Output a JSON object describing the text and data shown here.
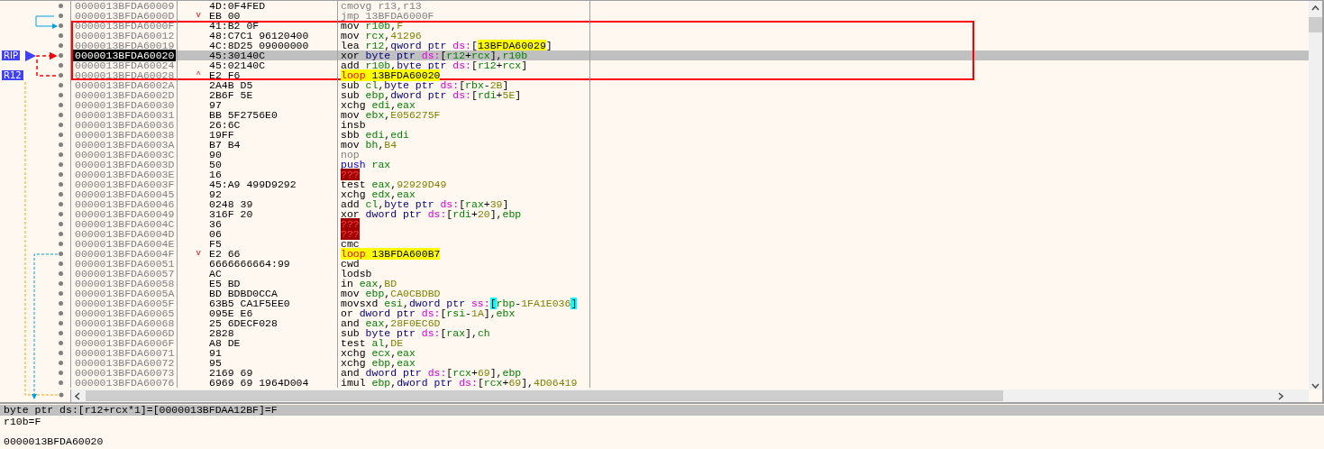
{
  "rows": [
    {
      "address": "0000013BFDA60009",
      "bytes": "4D:0F4FED",
      "selected": false,
      "current": false,
      "boxed": false,
      "disasm": [
        {
          "text": "cmovg r13,r13",
          "kind": "dim"
        }
      ]
    },
    {
      "address": "0000013BFDA6000D",
      "bytes": "EB 00",
      "jump_mark": "v",
      "selected": false,
      "current": false,
      "boxed": false,
      "disasm": [
        {
          "text": "jmp 13BFDA6000F",
          "kind": "dim"
        }
      ]
    },
    {
      "address": "0000013BFDA6000F",
      "bytes": "41:B2 0F",
      "selected": false,
      "current": false,
      "boxed": true,
      "disasm": [
        {
          "text": "mov ",
          "kind": "op"
        },
        {
          "text": "r10b",
          "kind": "reg"
        },
        {
          "text": ",",
          "kind": "txt"
        },
        {
          "text": "F",
          "kind": "num"
        }
      ]
    },
    {
      "address": "0000013BFDA60012",
      "bytes": "48:C7C1 96120400",
      "selected": false,
      "current": false,
      "boxed": true,
      "disasm": [
        {
          "text": "mov ",
          "kind": "op"
        },
        {
          "text": "rcx",
          "kind": "reg"
        },
        {
          "text": ",",
          "kind": "txt"
        },
        {
          "text": "41296",
          "kind": "num"
        }
      ]
    },
    {
      "address": "0000013BFDA60019",
      "bytes": "4C:8D25 09000000",
      "selected": false,
      "current": false,
      "boxed": true,
      "disasm": [
        {
          "text": "lea ",
          "kind": "op"
        },
        {
          "text": "r12",
          "kind": "reg"
        },
        {
          "text": ",",
          "kind": "txt"
        },
        {
          "text": "qword ptr ",
          "kind": "size"
        },
        {
          "text": "ds:",
          "kind": "seg"
        },
        {
          "text": "[",
          "kind": "txt"
        },
        {
          "text": "13BFDA60029",
          "kind": "addr"
        },
        {
          "text": "]",
          "kind": "txt"
        }
      ]
    },
    {
      "address": "0000013BFDA60020",
      "bytes": "45:30140C",
      "reg_label": "RIP",
      "selected": true,
      "current": true,
      "boxed": true,
      "disasm": [
        {
          "text": "xor ",
          "kind": "op"
        },
        {
          "text": "byte ptr ",
          "kind": "size"
        },
        {
          "text": "ds:",
          "kind": "seg"
        },
        {
          "text": "[",
          "kind": "txt"
        },
        {
          "text": "r12",
          "kind": "reg"
        },
        {
          "text": "+",
          "kind": "txt"
        },
        {
          "text": "rcx",
          "kind": "reg"
        },
        {
          "text": "],",
          "kind": "txt"
        },
        {
          "text": "r10b",
          "kind": "reg"
        }
      ]
    },
    {
      "address": "0000013BFDA60024",
      "bytes": "45:02140C",
      "selected": false,
      "current": false,
      "boxed": true,
      "disasm": [
        {
          "text": "add ",
          "kind": "op"
        },
        {
          "text": "r10b",
          "kind": "reg"
        },
        {
          "text": ",",
          "kind": "txt"
        },
        {
          "text": "byte ptr ",
          "kind": "size"
        },
        {
          "text": "ds:",
          "kind": "seg"
        },
        {
          "text": "[",
          "kind": "txt"
        },
        {
          "text": "r12",
          "kind": "reg"
        },
        {
          "text": "+",
          "kind": "txt"
        },
        {
          "text": "rcx",
          "kind": "reg"
        },
        {
          "text": "]",
          "kind": "txt"
        }
      ]
    },
    {
      "address": "0000013BFDA60028",
      "bytes": "E2 F6",
      "jump_mark": "^",
      "reg_label": "R12",
      "selected": false,
      "current": false,
      "boxed": true,
      "disasm": [
        {
          "text": "loop ",
          "kind": "loop"
        },
        {
          "text": "13BFDA60020",
          "kind": "addr"
        }
      ]
    },
    {
      "address": "0000013BFDA6002A",
      "bytes": "2A4B D5",
      "selected": false,
      "current": false,
      "boxed": false,
      "disasm": [
        {
          "text": "sub ",
          "kind": "op"
        },
        {
          "text": "cl",
          "kind": "reg"
        },
        {
          "text": ",",
          "kind": "txt"
        },
        {
          "text": "byte ptr ",
          "kind": "size"
        },
        {
          "text": "ds:",
          "kind": "seg"
        },
        {
          "text": "[",
          "kind": "txt"
        },
        {
          "text": "rbx",
          "kind": "reg"
        },
        {
          "text": "-",
          "kind": "txt"
        },
        {
          "text": "2B",
          "kind": "num"
        },
        {
          "text": "]",
          "kind": "txt"
        }
      ]
    },
    {
      "address": "0000013BFDA6002D",
      "bytes": "2B6F 5E",
      "selected": false,
      "current": false,
      "boxed": false,
      "disasm": [
        {
          "text": "sub ",
          "kind": "op"
        },
        {
          "text": "ebp",
          "kind": "reg"
        },
        {
          "text": ",",
          "kind": "txt"
        },
        {
          "text": "dword ptr ",
          "kind": "size"
        },
        {
          "text": "ds:",
          "kind": "seg"
        },
        {
          "text": "[",
          "kind": "txt"
        },
        {
          "text": "rdi",
          "kind": "reg"
        },
        {
          "text": "+",
          "kind": "txt"
        },
        {
          "text": "5E",
          "kind": "num"
        },
        {
          "text": "]",
          "kind": "txt"
        }
      ]
    },
    {
      "address": "0000013BFDA60030",
      "bytes": "97",
      "selected": false,
      "current": false,
      "boxed": false,
      "disasm": [
        {
          "text": "xchg ",
          "kind": "op"
        },
        {
          "text": "edi",
          "kind": "reg"
        },
        {
          "text": ",",
          "kind": "txt"
        },
        {
          "text": "eax",
          "kind": "reg"
        }
      ]
    },
    {
      "address": "0000013BFDA60031",
      "bytes": "BB 5F2756E0",
      "selected": false,
      "current": false,
      "boxed": false,
      "disasm": [
        {
          "text": "mov ",
          "kind": "op"
        },
        {
          "text": "ebx",
          "kind": "reg"
        },
        {
          "text": ",",
          "kind": "txt"
        },
        {
          "text": "E056275F",
          "kind": "num"
        }
      ]
    },
    {
      "address": "0000013BFDA60036",
      "bytes": "26:6C",
      "selected": false,
      "current": false,
      "boxed": false,
      "disasm": [
        {
          "text": "insb",
          "kind": "op"
        }
      ]
    },
    {
      "address": "0000013BFDA60038",
      "bytes": "19FF",
      "selected": false,
      "current": false,
      "boxed": false,
      "disasm": [
        {
          "text": "sbb ",
          "kind": "op"
        },
        {
          "text": "edi",
          "kind": "reg"
        },
        {
          "text": ",",
          "kind": "txt"
        },
        {
          "text": "edi",
          "kind": "reg"
        }
      ]
    },
    {
      "address": "0000013BFDA6003A",
      "bytes": "B7 B4",
      "selected": false,
      "current": false,
      "boxed": false,
      "disasm": [
        {
          "text": "mov ",
          "kind": "op"
        },
        {
          "text": "bh",
          "kind": "reg"
        },
        {
          "text": ",",
          "kind": "txt"
        },
        {
          "text": "B4",
          "kind": "num"
        }
      ]
    },
    {
      "address": "0000013BFDA6003C",
      "bytes": "90",
      "selected": false,
      "current": false,
      "boxed": false,
      "disasm": [
        {
          "text": "nop",
          "kind": "nop"
        }
      ]
    },
    {
      "address": "0000013BFDA6003D",
      "bytes": "50",
      "selected": false,
      "current": false,
      "boxed": false,
      "disasm": [
        {
          "text": "push ",
          "kind": "stack"
        },
        {
          "text": "rax",
          "kind": "reg"
        }
      ]
    },
    {
      "address": "0000013BFDA6003E",
      "bytes": "16",
      "selected": false,
      "current": false,
      "boxed": false,
      "disasm": [
        {
          "text": "???",
          "kind": "bad"
        }
      ]
    },
    {
      "address": "0000013BFDA6003F",
      "bytes": "45:A9 499D9292",
      "selected": false,
      "current": false,
      "boxed": false,
      "disasm": [
        {
          "text": "test ",
          "kind": "op"
        },
        {
          "text": "eax",
          "kind": "reg"
        },
        {
          "text": ",",
          "kind": "txt"
        },
        {
          "text": "92929D49",
          "kind": "num"
        }
      ]
    },
    {
      "address": "0000013BFDA60045",
      "bytes": "92",
      "selected": false,
      "current": false,
      "boxed": false,
      "disasm": [
        {
          "text": "xchg ",
          "kind": "op"
        },
        {
          "text": "edx",
          "kind": "reg"
        },
        {
          "text": ",",
          "kind": "txt"
        },
        {
          "text": "eax",
          "kind": "reg"
        }
      ]
    },
    {
      "address": "0000013BFDA60046",
      "bytes": "0248 39",
      "selected": false,
      "current": false,
      "boxed": false,
      "disasm": [
        {
          "text": "add ",
          "kind": "op"
        },
        {
          "text": "cl",
          "kind": "reg"
        },
        {
          "text": ",",
          "kind": "txt"
        },
        {
          "text": "byte ptr ",
          "kind": "size"
        },
        {
          "text": "ds:",
          "kind": "seg"
        },
        {
          "text": "[",
          "kind": "txt"
        },
        {
          "text": "rax",
          "kind": "reg"
        },
        {
          "text": "+",
          "kind": "txt"
        },
        {
          "text": "39",
          "kind": "num"
        },
        {
          "text": "]",
          "kind": "txt"
        }
      ]
    },
    {
      "address": "0000013BFDA60049",
      "bytes": "316F 20",
      "selected": false,
      "current": false,
      "boxed": false,
      "disasm": [
        {
          "text": "xor ",
          "kind": "op"
        },
        {
          "text": "dword ptr ",
          "kind": "size"
        },
        {
          "text": "ds:",
          "kind": "seg"
        },
        {
          "text": "[",
          "kind": "txt"
        },
        {
          "text": "rdi",
          "kind": "reg"
        },
        {
          "text": "+",
          "kind": "txt"
        },
        {
          "text": "20",
          "kind": "num"
        },
        {
          "text": "],",
          "kind": "txt"
        },
        {
          "text": "ebp",
          "kind": "reg"
        }
      ]
    },
    {
      "address": "0000013BFDA6004C",
      "bytes": "36",
      "selected": false,
      "current": false,
      "boxed": false,
      "disasm": [
        {
          "text": "???",
          "kind": "bad"
        }
      ]
    },
    {
      "address": "0000013BFDA6004D",
      "bytes": "06",
      "selected": false,
      "current": false,
      "boxed": false,
      "disasm": [
        {
          "text": "???",
          "kind": "bad"
        }
      ]
    },
    {
      "address": "0000013BFDA6004E",
      "bytes": "F5",
      "selected": false,
      "current": false,
      "boxed": false,
      "disasm": [
        {
          "text": "cmc",
          "kind": "op"
        }
      ]
    },
    {
      "address": "0000013BFDA6004F",
      "bytes": "E2 66",
      "jump_mark": "v",
      "selected": false,
      "current": false,
      "boxed": false,
      "disasm": [
        {
          "text": "loop ",
          "kind": "loop"
        },
        {
          "text": "13BFDA600B7",
          "kind": "addr"
        }
      ]
    },
    {
      "address": "0000013BFDA60051",
      "bytes": "6666666664:99",
      "selected": false,
      "current": false,
      "boxed": false,
      "disasm": [
        {
          "text": "cwd",
          "kind": "op"
        }
      ]
    },
    {
      "address": "0000013BFDA60057",
      "bytes": "AC",
      "selected": false,
      "current": false,
      "boxed": false,
      "disasm": [
        {
          "text": "lodsb",
          "kind": "op"
        }
      ]
    },
    {
      "address": "0000013BFDA60058",
      "bytes": "E5 BD",
      "selected": false,
      "current": false,
      "boxed": false,
      "disasm": [
        {
          "text": "in ",
          "kind": "op"
        },
        {
          "text": "eax",
          "kind": "reg"
        },
        {
          "text": ",",
          "kind": "txt"
        },
        {
          "text": "BD",
          "kind": "num"
        }
      ]
    },
    {
      "address": "0000013BFDA6005A",
      "bytes": "BD BDBD0CCA",
      "selected": false,
      "current": false,
      "boxed": false,
      "disasm": [
        {
          "text": "mov ",
          "kind": "op"
        },
        {
          "text": "ebp",
          "kind": "reg"
        },
        {
          "text": ",",
          "kind": "txt"
        },
        {
          "text": "CA0CBDBD",
          "kind": "num"
        }
      ]
    },
    {
      "address": "0000013BFDA6005F",
      "bytes": "63B5 CA1F5EE0",
      "selected": false,
      "current": false,
      "boxed": false,
      "disasm": [
        {
          "text": "movsxd ",
          "kind": "op"
        },
        {
          "text": "esi",
          "kind": "reg"
        },
        {
          "text": ",",
          "kind": "txt"
        },
        {
          "text": "dword ptr ",
          "kind": "size"
        },
        {
          "text": "ss:",
          "kind": "seg"
        },
        {
          "text": "[",
          "kind": "brk"
        },
        {
          "text": "rbp",
          "kind": "reg"
        },
        {
          "text": "-",
          "kind": "txt"
        },
        {
          "text": "1FA1E036",
          "kind": "num"
        },
        {
          "text": "]",
          "kind": "brk"
        }
      ]
    },
    {
      "address": "0000013BFDA60065",
      "bytes": "095E E6",
      "selected": false,
      "current": false,
      "boxed": false,
      "disasm": [
        {
          "text": "or ",
          "kind": "op"
        },
        {
          "text": "dword ptr ",
          "kind": "size"
        },
        {
          "text": "ds:",
          "kind": "seg"
        },
        {
          "text": "[",
          "kind": "txt"
        },
        {
          "text": "rsi",
          "kind": "reg"
        },
        {
          "text": "-",
          "kind": "txt"
        },
        {
          "text": "1A",
          "kind": "num"
        },
        {
          "text": "],",
          "kind": "txt"
        },
        {
          "text": "ebx",
          "kind": "reg"
        }
      ]
    },
    {
      "address": "0000013BFDA60068",
      "bytes": "25 6DECF028",
      "selected": false,
      "current": false,
      "boxed": false,
      "disasm": [
        {
          "text": "and ",
          "kind": "op"
        },
        {
          "text": "eax",
          "kind": "reg"
        },
        {
          "text": ",",
          "kind": "txt"
        },
        {
          "text": "28F0EC6D",
          "kind": "num"
        }
      ]
    },
    {
      "address": "0000013BFDA6006D",
      "bytes": "2828",
      "selected": false,
      "current": false,
      "boxed": false,
      "disasm": [
        {
          "text": "sub ",
          "kind": "op"
        },
        {
          "text": "byte ptr ",
          "kind": "size"
        },
        {
          "text": "ds:",
          "kind": "seg"
        },
        {
          "text": "[",
          "kind": "txt"
        },
        {
          "text": "rax",
          "kind": "reg"
        },
        {
          "text": "],",
          "kind": "txt"
        },
        {
          "text": "ch",
          "kind": "reg"
        }
      ]
    },
    {
      "address": "0000013BFDA6006F",
      "bytes": "A8 DE",
      "selected": false,
      "current": false,
      "boxed": false,
      "disasm": [
        {
          "text": "test ",
          "kind": "op"
        },
        {
          "text": "al",
          "kind": "reg"
        },
        {
          "text": ",",
          "kind": "txt"
        },
        {
          "text": "DE",
          "kind": "num"
        }
      ]
    },
    {
      "address": "0000013BFDA60071",
      "bytes": "91",
      "selected": false,
      "current": false,
      "boxed": false,
      "disasm": [
        {
          "text": "xchg ",
          "kind": "op"
        },
        {
          "text": "ecx",
          "kind": "reg"
        },
        {
          "text": ",",
          "kind": "txt"
        },
        {
          "text": "eax",
          "kind": "reg"
        }
      ]
    },
    {
      "address": "0000013BFDA60072",
      "bytes": "95",
      "selected": false,
      "current": false,
      "boxed": false,
      "disasm": [
        {
          "text": "xchg ",
          "kind": "op"
        },
        {
          "text": "ebp",
          "kind": "reg"
        },
        {
          "text": ",",
          "kind": "txt"
        },
        {
          "text": "eax",
          "kind": "reg"
        }
      ]
    },
    {
      "address": "0000013BFDA60073",
      "bytes": "2169 69",
      "selected": false,
      "current": false,
      "boxed": false,
      "disasm": [
        {
          "text": "and ",
          "kind": "op"
        },
        {
          "text": "dword ptr ",
          "kind": "size"
        },
        {
          "text": "ds:",
          "kind": "seg"
        },
        {
          "text": "[",
          "kind": "txt"
        },
        {
          "text": "rcx",
          "kind": "reg"
        },
        {
          "text": "+",
          "kind": "txt"
        },
        {
          "text": "69",
          "kind": "num"
        },
        {
          "text": "],",
          "kind": "txt"
        },
        {
          "text": "ebp",
          "kind": "reg"
        }
      ]
    },
    {
      "address": "0000013BFDA60076",
      "bytes": "6969 69 1964D004",
      "selected": false,
      "current": false,
      "boxed": false,
      "disasm": [
        {
          "text": "imul ",
          "kind": "op"
        },
        {
          "text": "ebp",
          "kind": "reg"
        },
        {
          "text": ",",
          "kind": "txt"
        },
        {
          "text": "dword ptr ",
          "kind": "size"
        },
        {
          "text": "ds:",
          "kind": "seg"
        },
        {
          "text": "[",
          "kind": "txt"
        },
        {
          "text": "rcx",
          "kind": "reg"
        },
        {
          "text": "+",
          "kind": "txt"
        },
        {
          "text": "69",
          "kind": "num"
        },
        {
          "text": "],",
          "kind": "txt"
        },
        {
          "text": "4D06419",
          "kind": "num"
        }
      ]
    }
  ],
  "info": {
    "operand_line": "byte ptr ds:[r12+rcx*1]=[0000013BFDAA12BF]=F",
    "register_line": "r10b=F",
    "address_line": "0000013BFDA60020"
  }
}
